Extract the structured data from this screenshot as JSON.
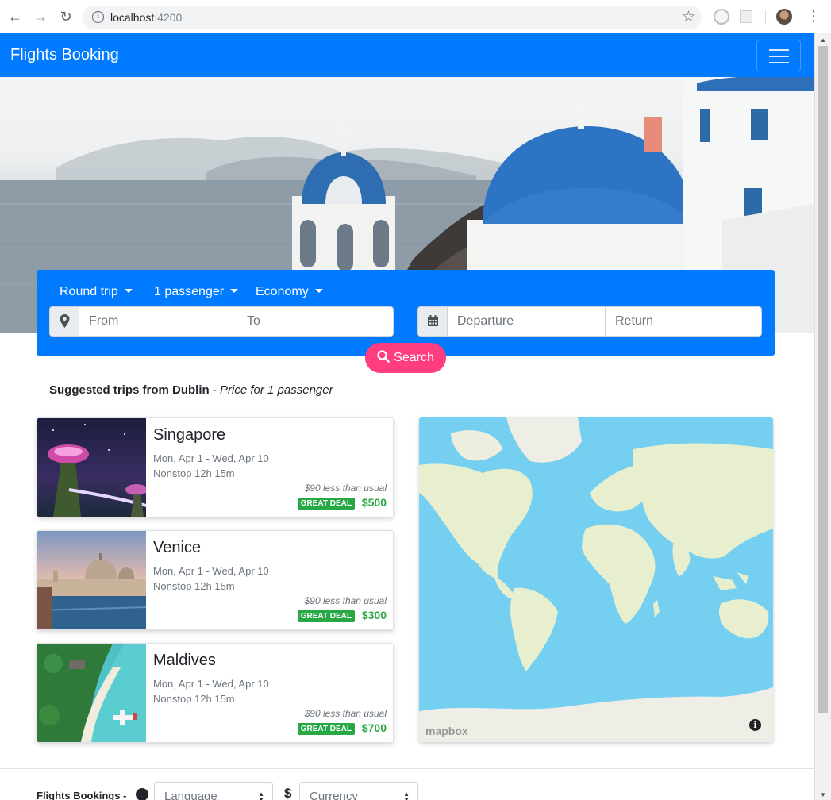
{
  "browser": {
    "url_host": "localhost",
    "url_port": ":4200"
  },
  "navbar": {
    "brand": "Flights Booking"
  },
  "search": {
    "trip_type": "Round trip",
    "passengers": "1 passenger",
    "cabin_class": "Economy",
    "from_placeholder": "From",
    "to_placeholder": "To",
    "departure_placeholder": "Departure",
    "return_placeholder": "Return",
    "button_label": "Search"
  },
  "suggested": {
    "heading": "Suggested trips from Dublin",
    "subheading": " - Price for 1 passenger"
  },
  "trips": [
    {
      "destination": "Singapore",
      "dates": "Mon, Apr 1 - Wed, Apr 10",
      "duration": "Nonstop 12h 15m",
      "savings": "$90 less than usual",
      "badge": "GREAT DEAL",
      "price": "$500"
    },
    {
      "destination": "Venice",
      "dates": "Mon, Apr 1 - Wed, Apr 10",
      "duration": "Nonstop 12h 15m",
      "savings": "$90 less than usual",
      "badge": "GREAT DEAL",
      "price": "$300"
    },
    {
      "destination": "Maldives",
      "dates": "Mon, Apr 1 - Wed, Apr 10",
      "duration": "Nonstop 12h 15m",
      "savings": "$90 less than usual",
      "badge": "GREAT DEAL",
      "price": "$700"
    }
  ],
  "map": {
    "logo": "mapbox",
    "info": "i"
  },
  "footer": {
    "title": "Flights Bookings -",
    "language_placeholder": "Language",
    "currency_placeholder": "Currency"
  }
}
